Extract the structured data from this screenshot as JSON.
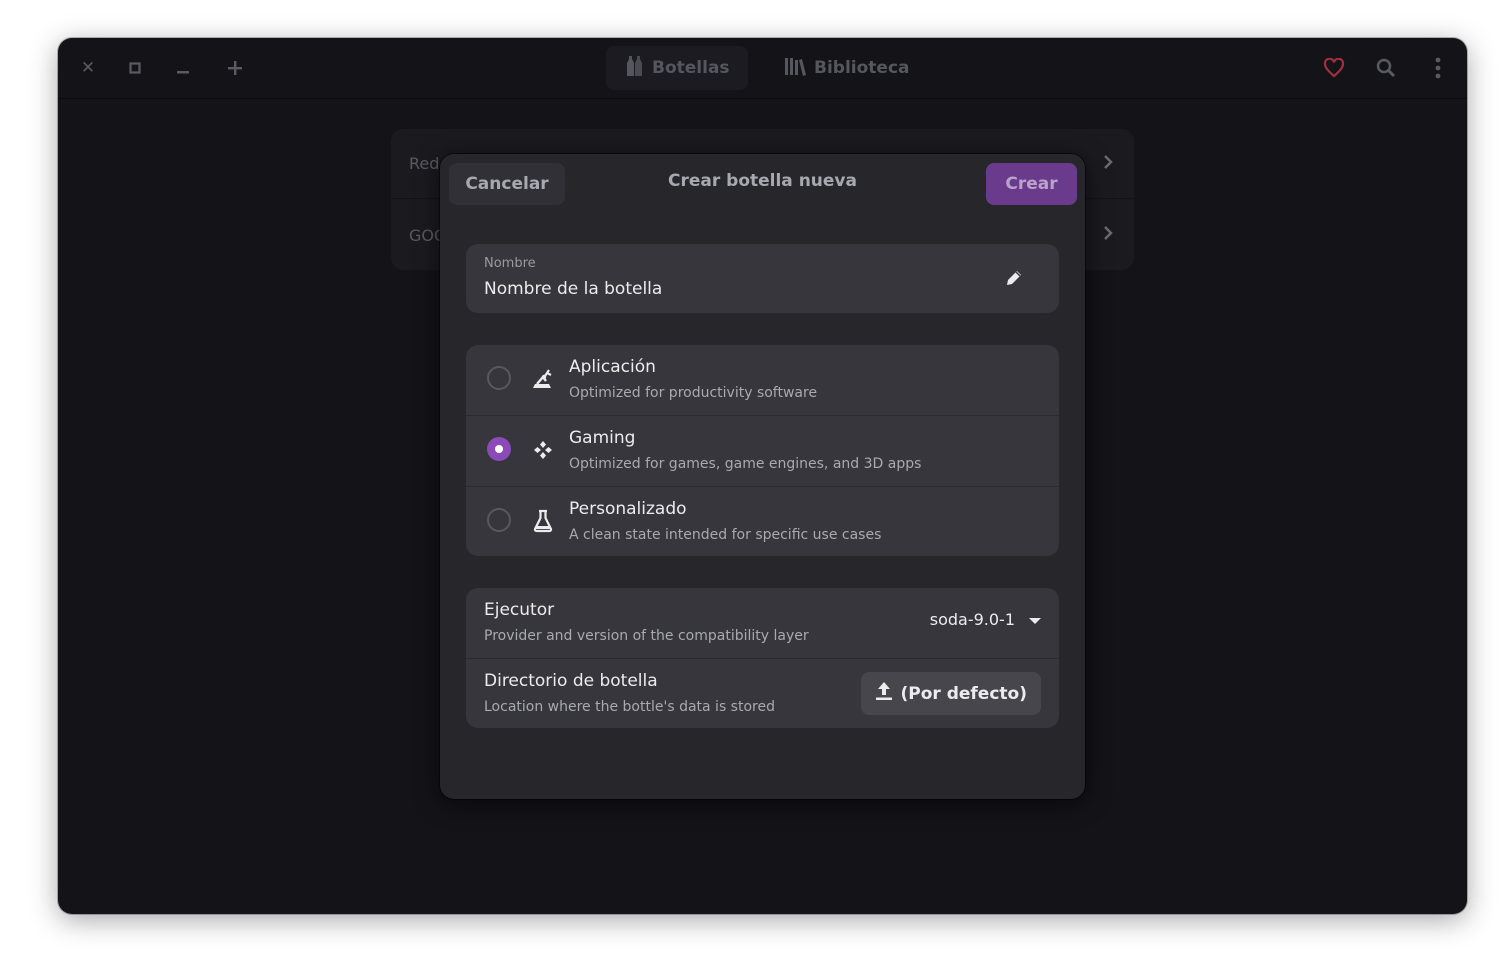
{
  "window": {
    "controls": {
      "close_icon": "close-icon",
      "maximize_icon": "maximize-icon",
      "minimize_icon": "minimize-icon",
      "add_icon": "plus-icon"
    },
    "tabs": [
      {
        "label": "Botellas",
        "icon": "bottles-icon",
        "active": true
      },
      {
        "label": "Biblioteca",
        "icon": "library-icon",
        "active": false
      }
    ],
    "header_icons": [
      "heart-icon",
      "search-icon",
      "menu-icon"
    ],
    "accent_color": "#8a4bb8",
    "heart_color": "#a03040"
  },
  "background_list": [
    {
      "label": "Red"
    },
    {
      "label": "GOG"
    }
  ],
  "dialog": {
    "cancel_label": "Cancelar",
    "title": "Crear botella nueva",
    "create_label": "Crear",
    "name": {
      "label": "Nombre",
      "value": "Nombre de la botella"
    },
    "environments": [
      {
        "title": "Aplicación",
        "subtitle": "Optimized for productivity software",
        "icon": "application-icon",
        "selected": false
      },
      {
        "title": "Gaming",
        "subtitle": "Optimized for games, game engines, and 3D apps",
        "icon": "gamepad-icon",
        "selected": true
      },
      {
        "title": "Personalizado",
        "subtitle": "A clean state intended for specific use cases",
        "icon": "flask-icon",
        "selected": false
      }
    ],
    "runner": {
      "title": "Ejecutor",
      "subtitle": "Provider and version of the compatibility layer",
      "value": "soda-9.0-1"
    },
    "directory": {
      "title": "Directorio de botella",
      "subtitle": "Location where the bottle's data is stored",
      "button_label": "(Por defecto)"
    }
  }
}
